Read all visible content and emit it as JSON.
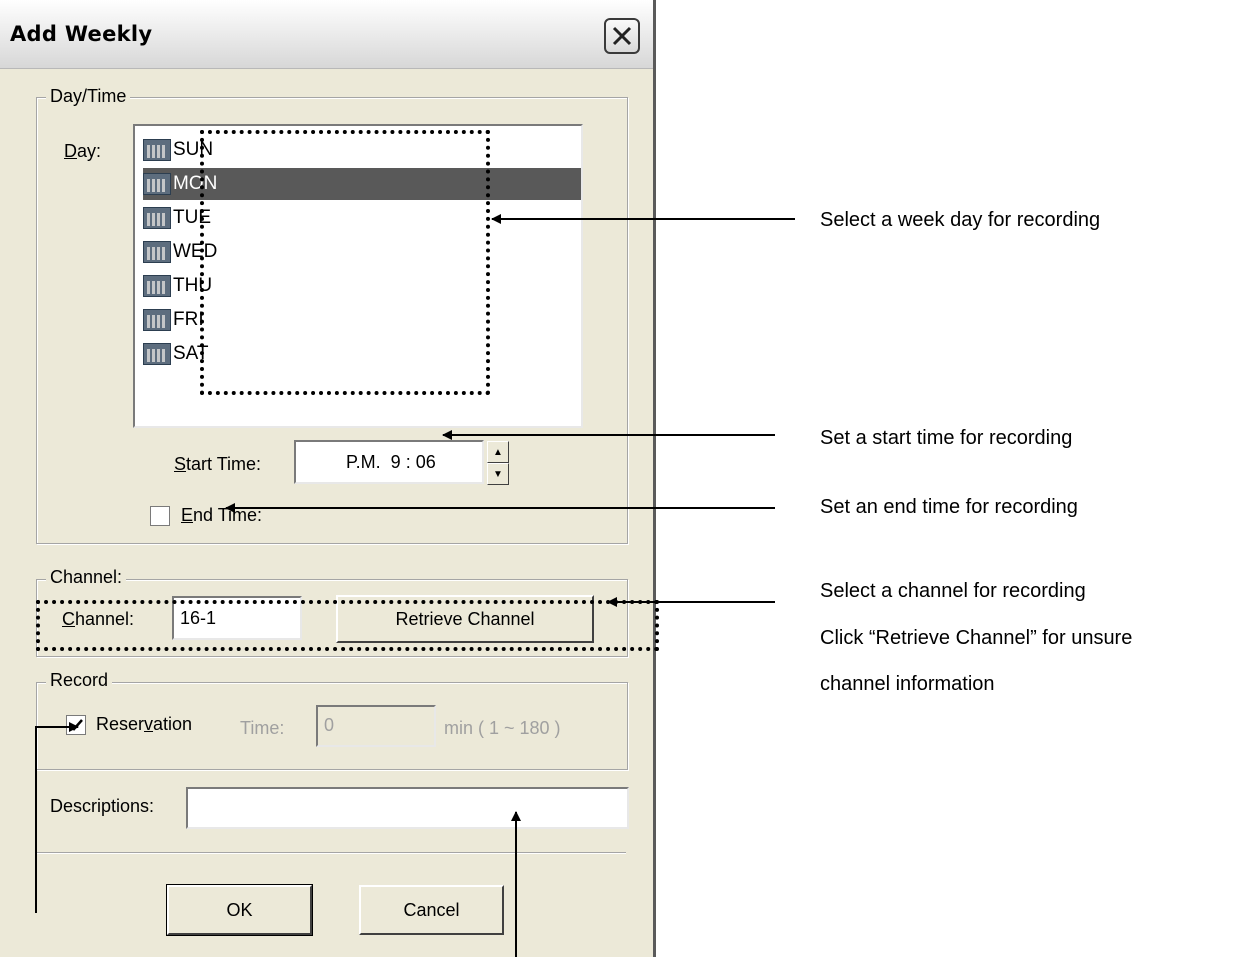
{
  "window": {
    "title": "Add Weekly"
  },
  "day_time": {
    "legend": "Day/Time",
    "day_label": "Day:",
    "days": [
      "SUN",
      "MON",
      "TUE",
      "WED",
      "THU",
      "FRI",
      "SAT"
    ],
    "selected_day": "MON",
    "start_time_label": "Start Time:",
    "start_time_value": "P.M.  9 : 06",
    "end_time_label": "End Time:",
    "end_time_checked": false
  },
  "channel": {
    "legend": "Channel:",
    "channel_label": "Channel:",
    "channel_value": "16-1",
    "retrieve_button": "Retrieve Channel"
  },
  "record": {
    "legend": "Record",
    "reservation_label": "Reservation",
    "reservation_checked": true,
    "time_label": "Time:",
    "time_value": "0",
    "time_unit": "min ( 1 ~ 180 )"
  },
  "descriptions": {
    "label": "Descriptions:",
    "value": ""
  },
  "buttons": {
    "ok": "OK",
    "cancel": "Cancel"
  },
  "annotations": {
    "day": "Select a week day for recording",
    "start_time": "Set a start time for recording",
    "end_time": "Set an end time for recording",
    "channel_line1": "Select a channel for recording",
    "channel_line2": "Click “Retrieve Channel” for unsure",
    "channel_line3": "channel information"
  }
}
